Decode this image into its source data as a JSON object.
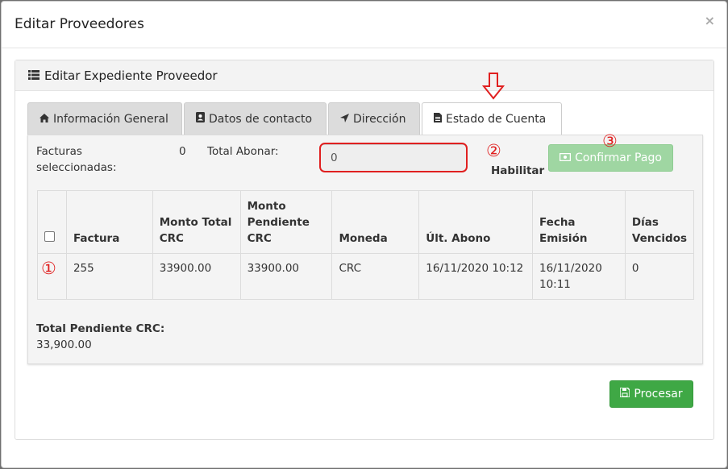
{
  "modal": {
    "title": "Editar Proveedores",
    "close": "×"
  },
  "panel": {
    "title": "Editar Expediente Proveedor"
  },
  "tabs": [
    {
      "label": "Información General",
      "icon": "home-icon"
    },
    {
      "label": "Datos de contacto",
      "icon": "contact-book-icon"
    },
    {
      "label": "Dirección",
      "icon": "location-arrow-icon"
    },
    {
      "label": "Estado de Cuenta",
      "icon": "document-icon",
      "active": true
    }
  ],
  "summary": {
    "facturas_label_1": "Facturas",
    "facturas_label_2": "seleccionadas:",
    "facturas_count": "0",
    "total_abonar_label": "Total Abonar:",
    "total_abonar_value": "0",
    "habilitar_label": "Habilitar",
    "confirmar_label": "Confirmar Pago"
  },
  "annotations": {
    "one": "①",
    "two": "②",
    "three": "③"
  },
  "table": {
    "headers": [
      "",
      "Factura",
      "Monto Total CRC",
      "Monto Pendiente CRC",
      "Moneda",
      "Últ. Abono",
      "Fecha Emisión",
      "Días Vencidos"
    ],
    "rows": [
      [
        "",
        "255",
        "33900.00",
        "33900.00",
        "CRC",
        "16/11/2020 10:12",
        "16/11/2020 10:11",
        "0"
      ]
    ]
  },
  "totals": {
    "label": "Total Pendiente CRC:",
    "value": "33,900.00"
  },
  "footer": {
    "procesar_label": "Procesar"
  },
  "colors": {
    "green": "#3fa845",
    "green_disabled": "#9fd6a2",
    "annotation_red": "#e02020"
  }
}
